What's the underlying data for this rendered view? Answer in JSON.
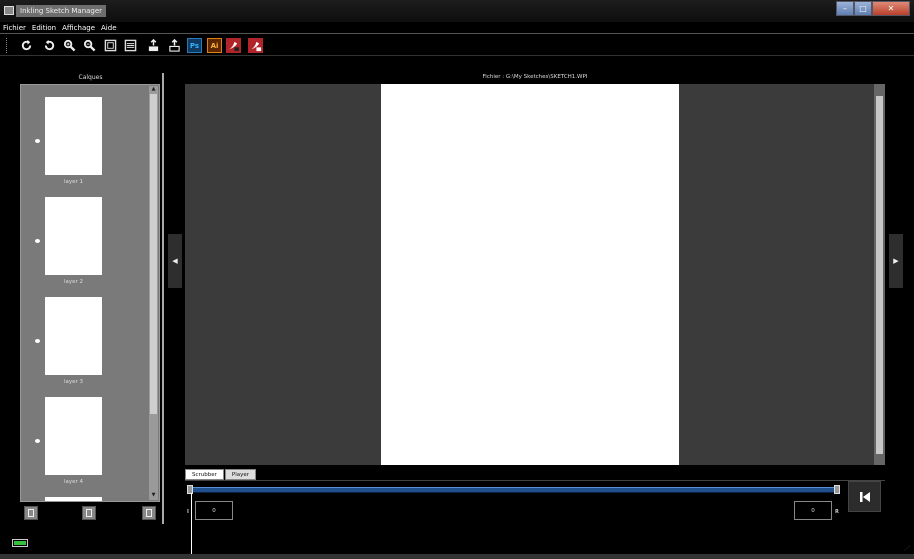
{
  "window": {
    "title": "Inkling Sketch Manager",
    "minimize_icon": "minimize-icon",
    "maximize_icon": "maximize-icon",
    "close_icon": "close-icon",
    "minimize_glyph": "–",
    "maximize_glyph": "□",
    "close_glyph": "✕"
  },
  "menu": {
    "items": [
      "Fichier",
      "Edition",
      "Affichage",
      "Aide"
    ]
  },
  "toolbar": {
    "photoshop_label": "Ps",
    "illustrator_label": "Ai",
    "icons": [
      "rotate-cw-icon",
      "rotate-ccw-icon",
      "zoom-in-icon",
      "zoom-out-icon",
      "fit-page-icon",
      "fit-width-icon",
      "export-icon",
      "share-icon",
      "photoshop-icon",
      "illustrator-icon",
      "sketchbook-icon",
      "sketchbook-pro-icon"
    ]
  },
  "layers": {
    "title": "Calques",
    "items": [
      {
        "label": "layer 1"
      },
      {
        "label": "layer 2"
      },
      {
        "label": "layer 3"
      },
      {
        "label": "layer 4"
      }
    ],
    "buttons": [
      "delete-layer-icon",
      "new-layer-icon",
      "duplicate-layer-icon"
    ]
  },
  "canvas": {
    "file_path": "Fichier : G:\\My Sketches\\SKETCH1.WPI",
    "prev_arrow": "◀",
    "next_arrow": "▶"
  },
  "timeline": {
    "tabs": [
      "Scrubber",
      "Player"
    ],
    "active_tab": "Scrubber",
    "start_label": "I",
    "start_value": "0",
    "end_label": "R",
    "end_value": "0",
    "scrubber_position": 0.0
  },
  "status": {
    "battery_icon": "battery-icon"
  },
  "colors": {
    "background": "#000000",
    "panel": "#7a7a7a",
    "canvas_frame": "#3b3b3b",
    "scrubber": "#1f4f8c",
    "battery": "#36c13a"
  }
}
